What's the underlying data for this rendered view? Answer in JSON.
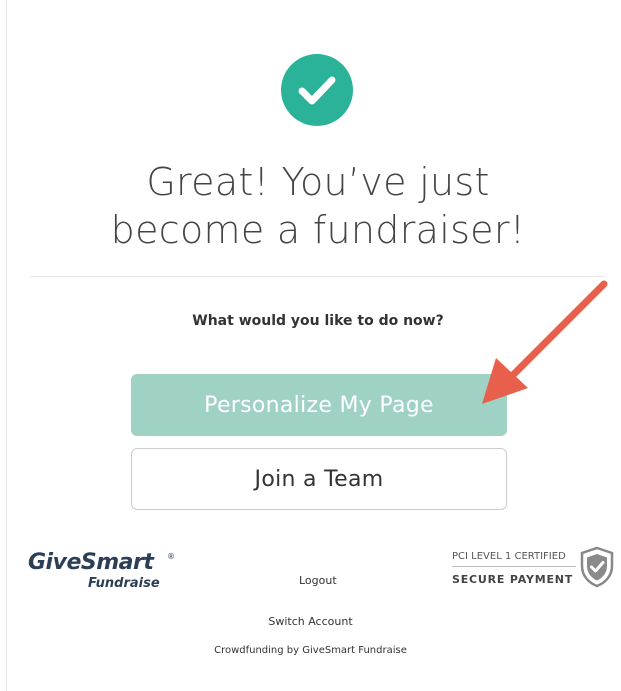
{
  "colors": {
    "accent": "#2bb39a",
    "primary_button": "#9fd1c5",
    "arrow": "#e8604c",
    "brand_navy": "#2d3f57"
  },
  "success_icon": "check-circle-icon",
  "headline": {
    "line1": "Great! You’ve just",
    "line2": "become a fundraiser!"
  },
  "prompt": "What would you like to do now?",
  "buttons": {
    "personalize_label": "Personalize My Page",
    "join_team_label": "Join a Team"
  },
  "footer": {
    "logo": {
      "name": "GiveSmart",
      "registered": "®",
      "sub": "Fundraise"
    },
    "logout_label": "Logout",
    "pci_certified": "PCI LEVEL 1 CERTIFIED",
    "secure_payment": "SECURE PAYMENT",
    "shield_icon": "shield-check-icon",
    "switch_account_label": "Switch Account",
    "crowdfunding_label": "Crowdfunding by GiveSmart Fundraise"
  }
}
